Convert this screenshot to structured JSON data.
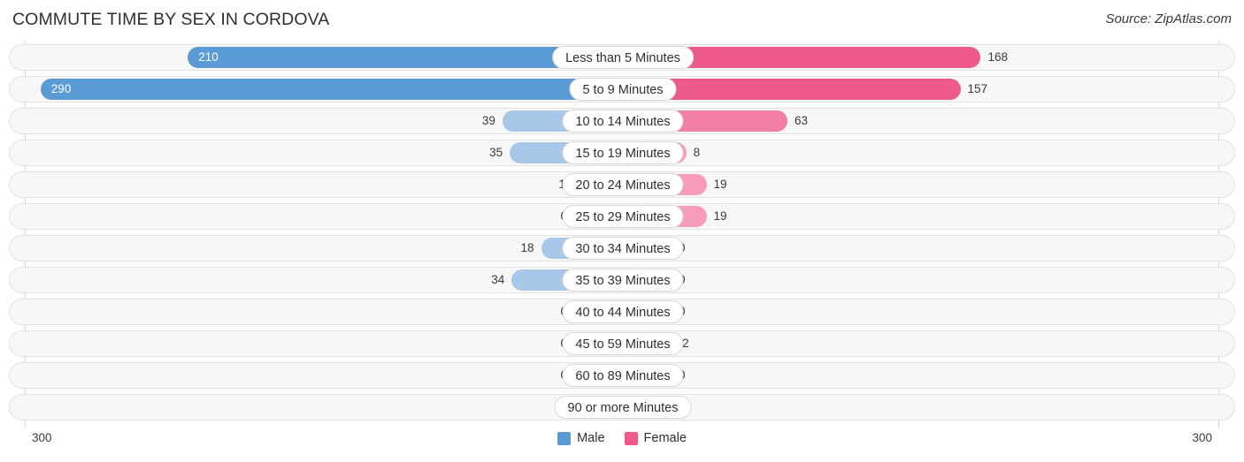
{
  "header": {
    "title": "COMMUTE TIME BY SEX IN CORDOVA",
    "source": "Source: ZipAtlas.com"
  },
  "footer": {
    "axis_left_label": "300",
    "axis_right_label": "300",
    "legend": [
      {
        "label": "Male",
        "color": "#5b9bd5"
      },
      {
        "label": "Female",
        "color": "#ef5a8c"
      }
    ]
  },
  "colors": {
    "male_strong": "#5b9bd5",
    "male_light": "#a8c8ea",
    "female_strong": "#ef5a8c",
    "female_mid": "#f17fa6",
    "female_light": "#f79dbb",
    "row_track": "#f7f7f7",
    "row_border": "#e2e2e2",
    "axis": "#d8d8d8",
    "text": "#3a3b3c"
  },
  "chart_data": {
    "type": "bar",
    "subtype": "diverging-bar",
    "title": "COMMUTE TIME BY SEX IN CORDOVA",
    "xlabel": "",
    "ylabel": "",
    "axis_max": 300,
    "axis_left_tick": "300",
    "axis_right_tick": "300",
    "grid": false,
    "legend_position": "bottom-center",
    "categories": [
      "Less than 5 Minutes",
      "5 to 9 Minutes",
      "10 to 14 Minutes",
      "15 to 19 Minutes",
      "20 to 24 Minutes",
      "25 to 29 Minutes",
      "30 to 34 Minutes",
      "35 to 39 Minutes",
      "40 to 44 Minutes",
      "45 to 59 Minutes",
      "60 to 89 Minutes",
      "90 or more Minutes"
    ],
    "series": [
      {
        "name": "Male",
        "color": "#5b9bd5",
        "values": [
          210,
          290,
          39,
          35,
          1,
          0,
          18,
          34,
          0,
          0,
          0,
          0
        ]
      },
      {
        "name": "Female",
        "color": "#ef5a8c",
        "values": [
          168,
          157,
          63,
          8,
          19,
          19,
          0,
          0,
          0,
          2,
          0,
          0
        ]
      }
    ]
  },
  "rows": [
    {
      "label": "Less than 5 Minutes",
      "male": "210",
      "female": "168"
    },
    {
      "label": "5 to 9 Minutes",
      "male": "290",
      "female": "157"
    },
    {
      "label": "10 to 14 Minutes",
      "male": "39",
      "female": "63"
    },
    {
      "label": "15 to 19 Minutes",
      "male": "35",
      "female": "8"
    },
    {
      "label": "20 to 24 Minutes",
      "male": "1",
      "female": "19"
    },
    {
      "label": "25 to 29 Minutes",
      "male": "0",
      "female": "19"
    },
    {
      "label": "30 to 34 Minutes",
      "male": "18",
      "female": "0"
    },
    {
      "label": "35 to 39 Minutes",
      "male": "34",
      "female": "0"
    },
    {
      "label": "40 to 44 Minutes",
      "male": "0",
      "female": "0"
    },
    {
      "label": "45 to 59 Minutes",
      "male": "0",
      "female": "2"
    },
    {
      "label": "60 to 89 Minutes",
      "male": "0",
      "female": "0"
    },
    {
      "label": "90 or more Minutes",
      "male": "0",
      "female": "0"
    }
  ]
}
